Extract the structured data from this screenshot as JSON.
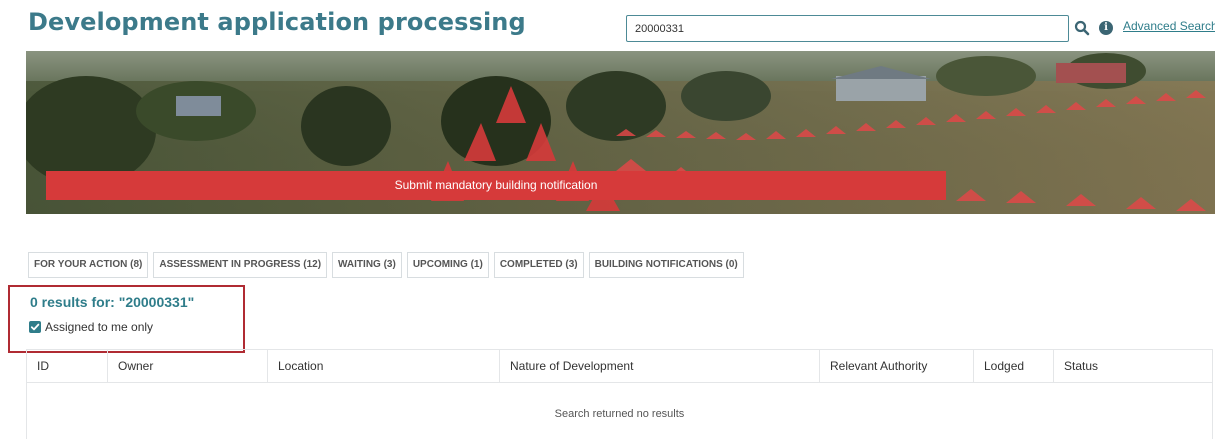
{
  "header": {
    "title": "Development application processing",
    "search_value": "20000331",
    "advanced_search_label": "Advanced Search",
    "search_icon": "search-icon",
    "info_icon": "info-icon",
    "info_glyph": "i"
  },
  "banner": {
    "submit_label": "Submit mandatory building notification",
    "accent_color": "#d63a3a"
  },
  "tabs": [
    {
      "label": "FOR YOUR ACTION (8)"
    },
    {
      "label": "ASSESSMENT IN PROGRESS (12)"
    },
    {
      "label": "WAITING (3)"
    },
    {
      "label": "UPCOMING (1)"
    },
    {
      "label": "COMPLETED (3)"
    },
    {
      "label": "BUILDING NOTIFICATIONS (0)"
    }
  ],
  "results": {
    "summary": "0 results for: \"20000331\"",
    "assigned_label": "Assigned to me only",
    "assigned_checked": true,
    "highlight_color": "#b02b33"
  },
  "table": {
    "columns": [
      "ID",
      "Owner",
      "Location",
      "Nature of Development",
      "Relevant Authority",
      "Lodged",
      "Status"
    ],
    "empty_message": "Search returned no results"
  },
  "colors": {
    "title": "#3c7a8a",
    "link": "#2f7d8a"
  }
}
